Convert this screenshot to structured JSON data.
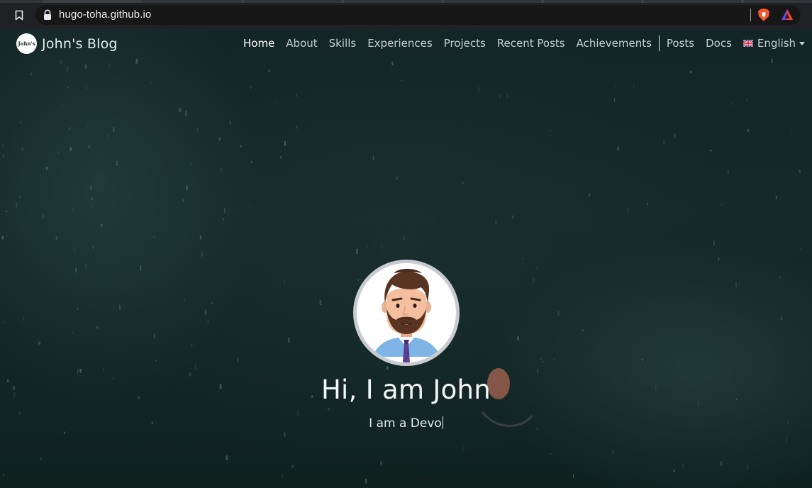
{
  "browser": {
    "url": "hugo-toha.github.io",
    "icons": [
      "bookmark-icon",
      "lock-icon",
      "brave-shields-icon",
      "brave-rewards-icon"
    ]
  },
  "navbar": {
    "brand_name": "John's Blog",
    "brand_logo_text": "John's",
    "items": [
      {
        "label": "Home",
        "active": true
      },
      {
        "label": "About"
      },
      {
        "label": "Skills"
      },
      {
        "label": "Experiences"
      },
      {
        "label": "Projects"
      },
      {
        "label": "Recent Posts"
      },
      {
        "label": "Achievements"
      }
    ],
    "secondary_items": [
      {
        "label": "Posts"
      },
      {
        "label": "Docs"
      }
    ],
    "language": {
      "selected": "English",
      "flag": "uk-flag-icon"
    }
  },
  "hero": {
    "avatar": "avatar-illustration",
    "title": "Hi, I am John",
    "subtitle": "I am a Devo"
  },
  "colors": {
    "background": "#132524",
    "nav_text": "#c5d0cf",
    "nav_active": "#ffffff",
    "hero_text": "#f4f7f7"
  }
}
